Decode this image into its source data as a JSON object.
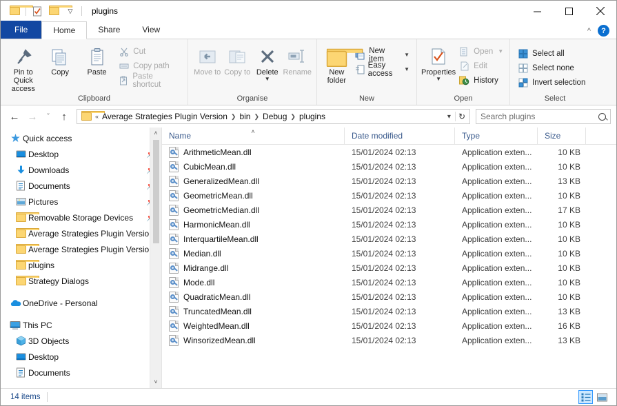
{
  "window": {
    "title": "plugins",
    "quick_access": [
      "folder-icon",
      "properties-check-icon",
      "new-folder-icon",
      "customize-dropdown-icon"
    ],
    "controls": {
      "minimize": "—",
      "maximize": "☐",
      "close": "✕"
    }
  },
  "ribbon": {
    "tabs": [
      {
        "label": "File",
        "kind": "file"
      },
      {
        "label": "Home",
        "kind": "active"
      },
      {
        "label": "Share",
        "kind": "normal"
      },
      {
        "label": "View",
        "kind": "normal"
      }
    ],
    "collapse_icon": "chevron-up-icon",
    "help_icon": "?",
    "groups": [
      {
        "title": "Clipboard",
        "big": [
          {
            "label": "Pin to Quick access",
            "icon": "pin-icon",
            "dim": false
          },
          {
            "label": "Copy",
            "icon": "copy-icon",
            "dim": false
          },
          {
            "label": "Paste",
            "icon": "paste-icon",
            "dim": false
          }
        ],
        "small": [
          {
            "label": "Cut",
            "icon": "scissors-icon",
            "dim": true
          },
          {
            "label": "Copy path",
            "icon": "copy-path-icon",
            "dim": true
          },
          {
            "label": "Paste shortcut",
            "icon": "paste-shortcut-icon",
            "dim": true
          }
        ]
      },
      {
        "title": "Organise",
        "big": [
          {
            "label": "Move to",
            "icon": "move-to-icon",
            "dim": true,
            "caret": true
          },
          {
            "label": "Copy to",
            "icon": "copy-to-icon",
            "dim": true,
            "caret": true
          },
          {
            "label": "Delete",
            "icon": "delete-x-icon",
            "dim": false,
            "dropdown": true
          },
          {
            "label": "Rename",
            "icon": "rename-icon",
            "dim": true
          }
        ],
        "small": []
      },
      {
        "title": "New",
        "big": [
          {
            "label": "New folder",
            "icon": "new-folder-icon",
            "dim": false
          }
        ],
        "small": [
          {
            "label": "New item",
            "icon": "new-item-icon",
            "dim": false,
            "caret": true
          },
          {
            "label": "Easy access",
            "icon": "easy-access-icon",
            "dim": false,
            "caret": true
          }
        ]
      },
      {
        "title": "Open",
        "big": [
          {
            "label": "Properties",
            "icon": "properties-icon",
            "dim": false,
            "dropdown": true
          }
        ],
        "small": [
          {
            "label": "Open",
            "icon": "open-icon",
            "dim": true,
            "caret": true
          },
          {
            "label": "Edit",
            "icon": "edit-icon",
            "dim": true
          },
          {
            "label": "History",
            "icon": "history-icon",
            "dim": false
          }
        ]
      },
      {
        "title": "Select",
        "big": [],
        "small": [
          {
            "label": "Select all",
            "icon": "select-all-icon",
            "dim": false
          },
          {
            "label": "Select none",
            "icon": "select-none-icon",
            "dim": false
          },
          {
            "label": "Invert selection",
            "icon": "invert-selection-icon",
            "dim": false
          }
        ]
      }
    ]
  },
  "addressbar": {
    "back_icon": "←",
    "forward_icon": "→",
    "recent_icon": "ˇ",
    "up_icon": "↑",
    "overflow": "«",
    "crumbs": [
      "Average Strategies Plugin Version",
      "bin",
      "Debug",
      "plugins"
    ],
    "dropdown_icon": "ˇ",
    "refresh_icon": "↻",
    "search_placeholder": "Search plugins",
    "search_value": ""
  },
  "navpane": {
    "groups": [
      {
        "items": [
          {
            "label": "Quick access",
            "icon": "star-pin-icon",
            "indent": 0,
            "pinned": false
          },
          {
            "label": "Desktop",
            "icon": "desktop-icon",
            "indent": 1,
            "pinned": true
          },
          {
            "label": "Downloads",
            "icon": "downloads-icon",
            "indent": 1,
            "pinned": true
          },
          {
            "label": "Documents",
            "icon": "documents-icon",
            "indent": 1,
            "pinned": true
          },
          {
            "label": "Pictures",
            "icon": "pictures-icon",
            "indent": 1,
            "pinned": true
          },
          {
            "label": "Removable Storage Devices",
            "icon": "folder-icon",
            "indent": 1,
            "pinned": true
          },
          {
            "label": "Average Strategies Plugin Version",
            "icon": "folder-icon",
            "indent": 1,
            "pinned": false
          },
          {
            "label": "Average Strategies Plugin Version",
            "icon": "folder-icon",
            "indent": 1,
            "pinned": false
          },
          {
            "label": "plugins",
            "icon": "folder-icon",
            "indent": 1,
            "pinned": false
          },
          {
            "label": "Strategy Dialogs",
            "icon": "folder-icon",
            "indent": 1,
            "pinned": false
          }
        ]
      },
      {
        "items": [
          {
            "label": "OneDrive - Personal",
            "icon": "onedrive-cloud-icon",
            "indent": 0,
            "pinned": false
          }
        ]
      },
      {
        "items": [
          {
            "label": "This PC",
            "icon": "this-pc-icon",
            "indent": 0,
            "pinned": false
          },
          {
            "label": "3D Objects",
            "icon": "3d-objects-icon",
            "indent": 1,
            "pinned": false
          },
          {
            "label": "Desktop",
            "icon": "desktop-icon",
            "indent": 1,
            "pinned": false
          },
          {
            "label": "Documents",
            "icon": "documents-icon",
            "indent": 1,
            "pinned": false
          }
        ]
      }
    ],
    "scroll_up_icon": "˄",
    "scroll_down_icon": "˅"
  },
  "filelist": {
    "columns": [
      {
        "label": "Name",
        "sorted": true,
        "sort_icon": "˄"
      },
      {
        "label": "Date modified",
        "sorted": false
      },
      {
        "label": "Type",
        "sorted": false
      },
      {
        "label": "Size",
        "sorted": false
      }
    ],
    "rows": [
      {
        "name": "ArithmeticMean.dll",
        "date": "15/01/2024 02:13",
        "type": "Application exten...",
        "size": "10 KB",
        "icon": "dll-icon"
      },
      {
        "name": "CubicMean.dll",
        "date": "15/01/2024 02:13",
        "type": "Application exten...",
        "size": "10 KB",
        "icon": "dll-icon"
      },
      {
        "name": "GeneralizedMean.dll",
        "date": "15/01/2024 02:13",
        "type": "Application exten...",
        "size": "13 KB",
        "icon": "dll-icon"
      },
      {
        "name": "GeometricMean.dll",
        "date": "15/01/2024 02:13",
        "type": "Application exten...",
        "size": "10 KB",
        "icon": "dll-icon"
      },
      {
        "name": "GeometricMedian.dll",
        "date": "15/01/2024 02:13",
        "type": "Application exten...",
        "size": "17 KB",
        "icon": "dll-icon"
      },
      {
        "name": "HarmonicMean.dll",
        "date": "15/01/2024 02:13",
        "type": "Application exten...",
        "size": "10 KB",
        "icon": "dll-icon"
      },
      {
        "name": "InterquartileMean.dll",
        "date": "15/01/2024 02:13",
        "type": "Application exten...",
        "size": "10 KB",
        "icon": "dll-icon"
      },
      {
        "name": "Median.dll",
        "date": "15/01/2024 02:13",
        "type": "Application exten...",
        "size": "10 KB",
        "icon": "dll-icon"
      },
      {
        "name": "Midrange.dll",
        "date": "15/01/2024 02:13",
        "type": "Application exten...",
        "size": "10 KB",
        "icon": "dll-icon"
      },
      {
        "name": "Mode.dll",
        "date": "15/01/2024 02:13",
        "type": "Application exten...",
        "size": "10 KB",
        "icon": "dll-icon"
      },
      {
        "name": "QuadraticMean.dll",
        "date": "15/01/2024 02:13",
        "type": "Application exten...",
        "size": "10 KB",
        "icon": "dll-icon"
      },
      {
        "name": "TruncatedMean.dll",
        "date": "15/01/2024 02:13",
        "type": "Application exten...",
        "size": "13 KB",
        "icon": "dll-icon"
      },
      {
        "name": "WeightedMean.dll",
        "date": "15/01/2024 02:13",
        "type": "Application exten...",
        "size": "16 KB",
        "icon": "dll-icon"
      },
      {
        "name": "WinsorizedMean.dll",
        "date": "15/01/2024 02:13",
        "type": "Application exten...",
        "size": "13 KB",
        "icon": "dll-icon"
      }
    ]
  },
  "statusbar": {
    "item_count": "14 items",
    "views": [
      {
        "name": "details-view-button",
        "selected": true
      },
      {
        "name": "large-icons-view-button",
        "selected": false
      }
    ]
  },
  "colors": {
    "file_tab": "#1348a2",
    "help_blue": "#0a6fd0",
    "header_text": "#3a5a8c",
    "status_text": "#1c4a8a",
    "folder_yellow": "#fcd673",
    "selection_blue": "#cce8ff"
  }
}
